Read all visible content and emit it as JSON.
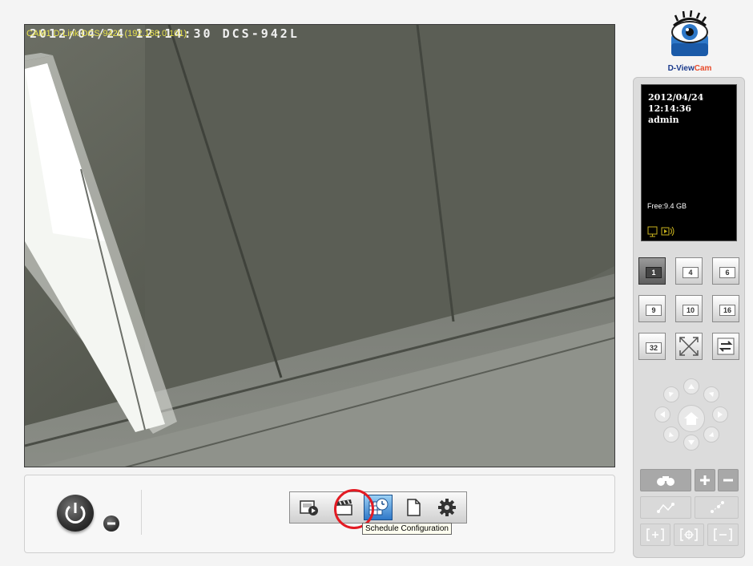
{
  "video": {
    "osd_text": "2012/04/24 12:14:30 DCS-942L",
    "camera_label": "CAM1 D-Link DCS-942L (192.168.0.101)"
  },
  "toolbar": {
    "buttons": [
      {
        "name": "playback",
        "icon": "playback-icon"
      },
      {
        "name": "recording",
        "icon": "clapperboard-icon"
      },
      {
        "name": "schedule",
        "icon": "schedule-icon",
        "active": true
      },
      {
        "name": "log",
        "icon": "document-icon"
      },
      {
        "name": "settings",
        "icon": "gear-icon"
      }
    ],
    "tooltip": "Schedule Configuration"
  },
  "logo": {
    "text_dview": "D-View",
    "text_cam": "Cam"
  },
  "info": {
    "date": "2012/04/24",
    "time": "12:14:36",
    "user": "admin",
    "free": "Free:9.4 GB"
  },
  "layouts": [
    {
      "label": "1",
      "selected": true
    },
    {
      "label": "4"
    },
    {
      "label": "6"
    },
    {
      "label": "9"
    },
    {
      "label": "10"
    },
    {
      "label": "16"
    },
    {
      "label": "32"
    },
    {
      "label": "",
      "icon": "fullscreen-icon"
    },
    {
      "label": "",
      "icon": "switch-icon"
    }
  ],
  "colors": {
    "accent": "#2f78c8",
    "highlight": "#e31b23",
    "osd_label": "#e8e24c"
  }
}
